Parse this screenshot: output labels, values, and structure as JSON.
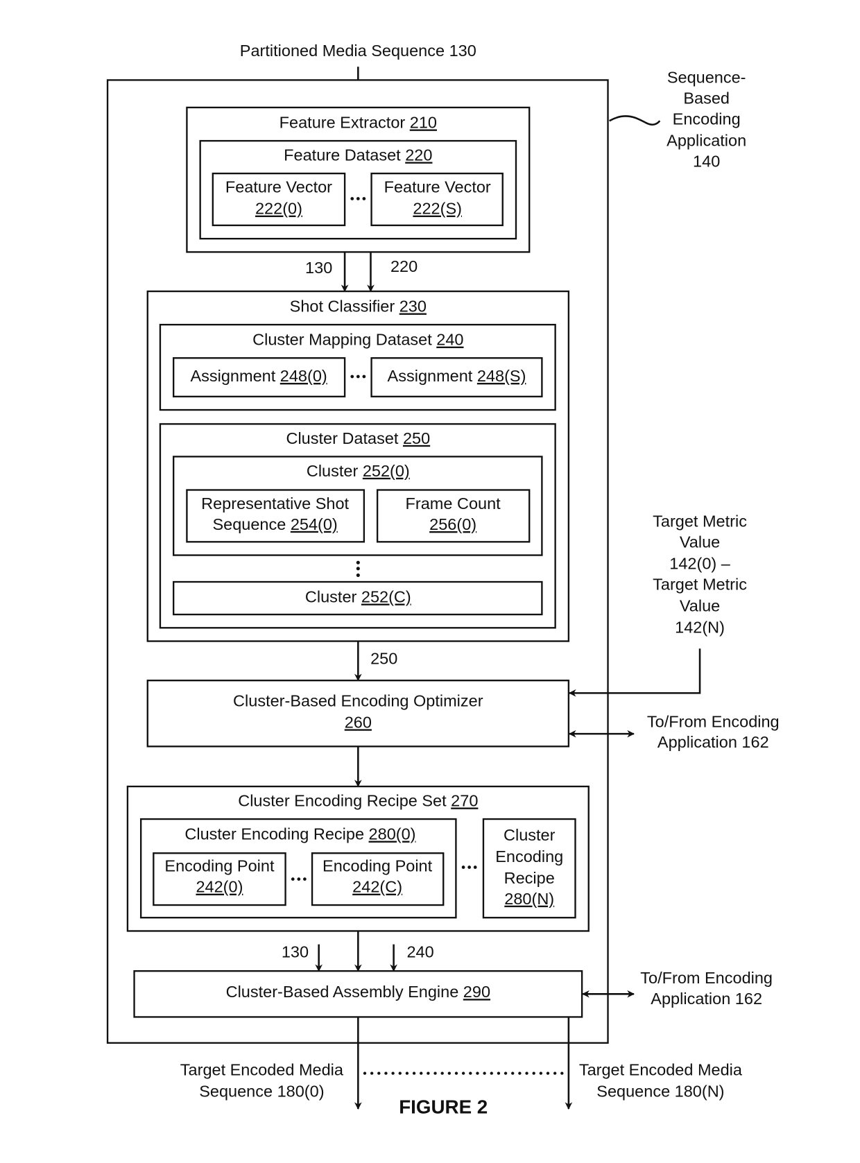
{
  "figure_label": "FIGURE 2",
  "input": {
    "label": "Partitioned Media Sequence 130"
  },
  "application": {
    "lines": [
      "Sequence-",
      "Based",
      "Encoding",
      "Application",
      "140"
    ]
  },
  "feature_extractor": {
    "name": "Feature Extractor ",
    "ref": "210",
    "dataset": {
      "name": "Feature Dataset ",
      "ref": "220",
      "vectors": [
        {
          "name": "Feature Vector",
          "ref": "222(0)"
        },
        {
          "name": "Feature Vector",
          "ref": "222(S)"
        }
      ]
    }
  },
  "connector_labels": {
    "a130": "130",
    "a220": "220",
    "a250": "250",
    "b130": "130",
    "b240": "240"
  },
  "shot_classifier": {
    "name": "Shot Classifier ",
    "ref": "230",
    "mapping_dataset": {
      "name": "Cluster Mapping Dataset ",
      "ref": "240",
      "assignments": [
        {
          "name": "Assignment ",
          "ref": "248(0)"
        },
        {
          "name": "Assignment ",
          "ref": "248(S)"
        }
      ]
    },
    "cluster_dataset": {
      "name": "Cluster Dataset ",
      "ref": "250",
      "cluster_first": {
        "name": "Cluster ",
        "ref": "252(0)",
        "rep_shot": {
          "line1": "Representative Shot",
          "line2": "Sequence ",
          "ref": "254(0)"
        },
        "frame_count": {
          "line1": "Frame Count",
          "ref": "256(0)"
        }
      },
      "cluster_last": {
        "name": "Cluster ",
        "ref": "252(C)"
      }
    }
  },
  "target_metric": {
    "lines": [
      "Target Metric",
      "Value",
      "142(0) –",
      "Target Metric",
      "Value",
      "142(N)"
    ]
  },
  "optimizer": {
    "name": "Cluster-Based Encoding Optimizer",
    "ref": "260"
  },
  "to_from_1": {
    "line1": "To/From Encoding",
    "line2": "Application 162"
  },
  "recipe_set": {
    "name": "Cluster Encoding Recipe Set ",
    "ref": "270",
    "recipe_first": {
      "name": "Cluster Encoding Recipe ",
      "ref": "280(0)",
      "points": [
        {
          "name": "Encoding Point",
          "ref": "242(0)"
        },
        {
          "name": "Encoding Point",
          "ref": "242(C)"
        }
      ]
    },
    "recipe_last": {
      "lines": [
        "Cluster",
        "Encoding",
        "Recipe"
      ],
      "ref": "280(N)"
    }
  },
  "assembly_engine": {
    "name": "Cluster-Based Assembly Engine ",
    "ref": "290"
  },
  "to_from_2": {
    "line1": "To/From Encoding",
    "line2": "Application 162"
  },
  "outputs": [
    {
      "line1": "Target Encoded Media",
      "line2": "Sequence 180(0)"
    },
    {
      "line1": "Target Encoded Media",
      "line2": "Sequence 180(N)"
    }
  ]
}
